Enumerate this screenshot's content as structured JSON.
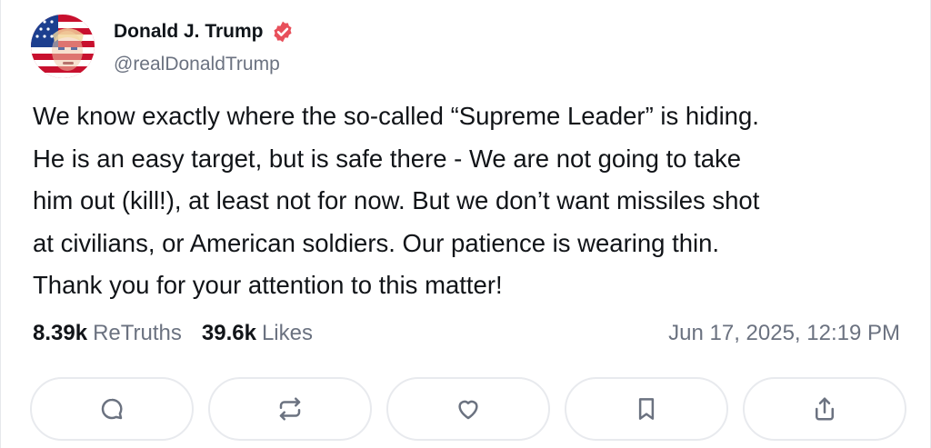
{
  "user": {
    "display_name": "Donald J. Trump",
    "handle": "@realDonaldTrump",
    "avatar_icon": "avatar-flag-portrait",
    "verified_icon": "verified-badge-icon",
    "verified_color": "#e8505b"
  },
  "post": {
    "lines": [
      "We know exactly where the so-called “Supreme Leader” is hiding.",
      "He is an easy target, but is safe there - We are not going to take",
      "him out (kill!), at least not for now. But we don’t want missiles shot",
      "at civilians, or American soldiers. Our patience is wearing thin.",
      "Thank you for your attention to this matter!"
    ]
  },
  "stats": {
    "retruths_count": "8.39k",
    "retruths_label": "ReTruths",
    "likes_count": "39.6k",
    "likes_label": "Likes",
    "timestamp": "Jun 17, 2025, 12:19 PM"
  },
  "actions": [
    {
      "name": "reply",
      "icon": "comment-icon"
    },
    {
      "name": "retruth",
      "icon": "repost-icon"
    },
    {
      "name": "like",
      "icon": "heart-icon"
    },
    {
      "name": "bookmark",
      "icon": "bookmark-icon"
    },
    {
      "name": "share",
      "icon": "share-icon"
    }
  ],
  "colors": {
    "text": "#111418",
    "muted": "#6b7280",
    "button_border": "#e8eaee",
    "icon": "#6b7280"
  }
}
